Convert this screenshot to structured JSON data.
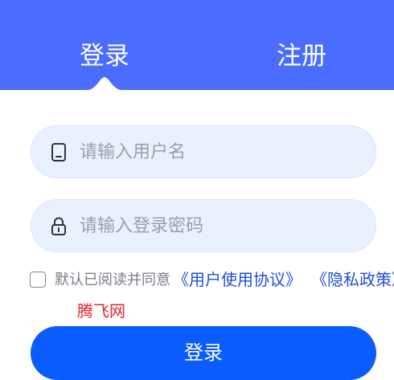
{
  "header": {
    "tabs": [
      {
        "label": "登录",
        "active": true
      },
      {
        "label": "注册",
        "active": false
      }
    ],
    "bg_color": "#4a6cff"
  },
  "form": {
    "username": {
      "placeholder": "请输入用户名",
      "value": "",
      "icon": "phone-icon"
    },
    "password": {
      "placeholder": "请输入登录密码",
      "value": "",
      "icon": "lock-icon"
    }
  },
  "agreement": {
    "checked": false,
    "text": "默认已阅读并同意",
    "user_agreement": "《用户使用协议》",
    "privacy_policy": "《隐私政策》"
  },
  "watermark": "腾飞网",
  "login_button": {
    "label": "登录",
    "color": "#0a5cff"
  }
}
